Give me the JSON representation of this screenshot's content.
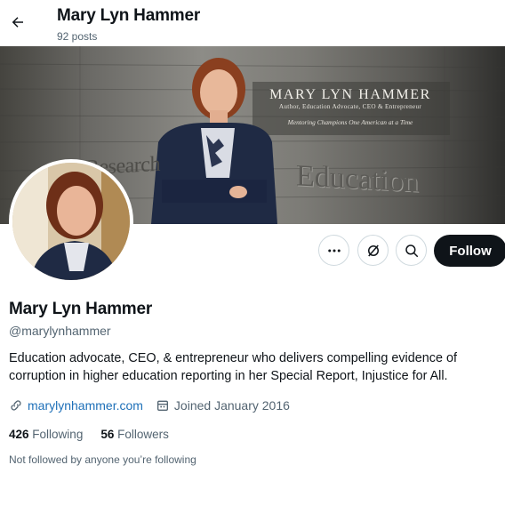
{
  "header": {
    "name": "Mary Lyn Hammer",
    "posts": "92 posts"
  },
  "banner": {
    "title": "MARY LYN HAMMER",
    "subtitle": "Author, Education Advocate, CEO & Entrepreneur",
    "tagline": "Mentoring Champions One American at a Time",
    "wall_left": "Research",
    "wall_right": "Education"
  },
  "actions": {
    "more_icon": "more-icon",
    "grok_icon": "grok-icon",
    "search_icon": "search-icon",
    "follow_label": "Follow"
  },
  "profile": {
    "name": "Mary Lyn Hammer",
    "handle": "@marylynhammer",
    "bio": "Education advocate, CEO, & entrepreneur who delivers compelling evidence of corruption in higher education reporting in her Special Report, Injustice for All.",
    "website": "marylynhammer.com",
    "joined": "Joined January 2016",
    "following_count": "426",
    "following_label": "Following",
    "followers_count": "56",
    "followers_label": "Followers",
    "not_followed": "Not followed by anyone you’re following"
  },
  "colors": {
    "text": "#0f1419",
    "secondary": "#536471",
    "link": "#1d6fb8",
    "border": "#cfd9de",
    "follow_bg": "#0f1419"
  }
}
